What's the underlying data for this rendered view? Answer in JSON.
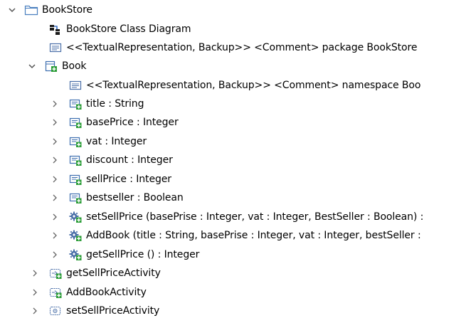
{
  "tree": {
    "items": [
      {
        "label": "BookStore",
        "icon": "package-icon",
        "twisty": "expanded"
      },
      {
        "label": "BookStore Class Diagram",
        "icon": "class-diagram-icon",
        "twisty": "none"
      },
      {
        "label": "<<TextualRepresentation, Backup>> <Comment> package BookStore",
        "icon": "comment-icon",
        "twisty": "none"
      },
      {
        "label": "Book",
        "icon": "class-icon",
        "twisty": "expanded"
      },
      {
        "label": "<<TextualRepresentation, Backup>> <Comment> namespace Boo",
        "icon": "comment-icon",
        "twisty": "none"
      },
      {
        "label": "title : String",
        "icon": "property-icon",
        "twisty": "collapsed"
      },
      {
        "label": "basePrice : Integer",
        "icon": "property-icon",
        "twisty": "collapsed"
      },
      {
        "label": "vat : Integer",
        "icon": "property-icon",
        "twisty": "collapsed"
      },
      {
        "label": "discount : Integer",
        "icon": "property-icon",
        "twisty": "collapsed"
      },
      {
        "label": "sellPrice : Integer",
        "icon": "property-icon",
        "twisty": "collapsed"
      },
      {
        "label": "bestseller : Boolean",
        "icon": "property-icon",
        "twisty": "collapsed"
      },
      {
        "label": "setSellPrice (basePrise : Integer, vat : Integer, BestSeller : Boolean) :",
        "icon": "operation-icon",
        "twisty": "collapsed"
      },
      {
        "label": "AddBook (title : String, basePrise : Integer, vat : Integer, bestSeller :",
        "icon": "operation-icon",
        "twisty": "collapsed"
      },
      {
        "label": "getSellPrice () : Integer",
        "icon": "operation-icon",
        "twisty": "collapsed"
      },
      {
        "label": "getSellPriceActivity",
        "icon": "activity-icon",
        "twisty": "collapsed"
      },
      {
        "label": "AddBookActivity",
        "icon": "activity-icon",
        "twisty": "collapsed"
      },
      {
        "label": "setSellPriceActivity",
        "icon": "activity-icon",
        "twisty": "collapsed"
      }
    ]
  },
  "colors": {
    "twisty": "#555555",
    "folder_outline": "#4a7fbf",
    "class_green": "#2e9e3a",
    "property_blue": "#3e6fb0",
    "gear_blue": "#4a6fa8"
  }
}
